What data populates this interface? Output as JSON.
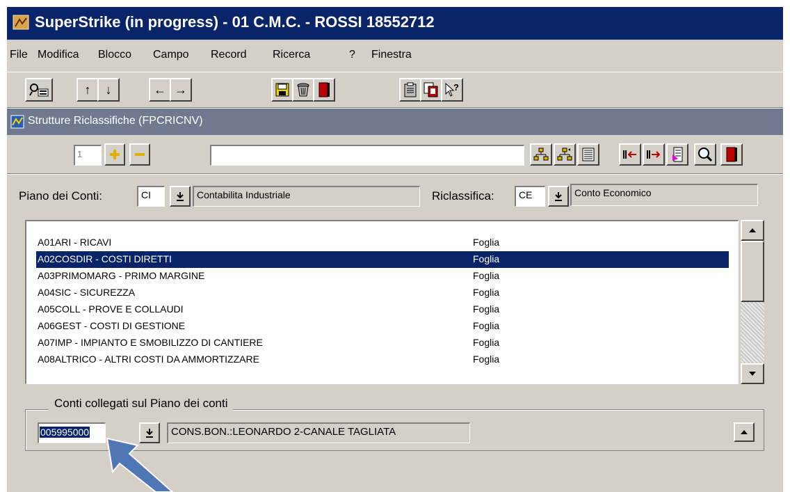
{
  "window": {
    "title": "SuperStrike (in progress) - 01 C.M.C. - ROSSI 18552712"
  },
  "menu": [
    "File",
    "Modifica",
    "Blocco",
    "Campo",
    "Record",
    "Ricerca",
    "?",
    "Finestra"
  ],
  "toolbar": {
    "buttons": [
      {
        "name": "query-icon"
      },
      {
        "name": "arrow-up-icon",
        "glyph": "↑"
      },
      {
        "name": "arrow-down-icon",
        "glyph": "↓"
      },
      {
        "name": "arrow-left-icon",
        "glyph": "←"
      },
      {
        "name": "arrow-right-icon",
        "glyph": "→"
      },
      {
        "name": "save-icon"
      },
      {
        "name": "trash-icon"
      },
      {
        "name": "exit-door-icon"
      },
      {
        "name": "clipboard-icon"
      },
      {
        "name": "copy-icon"
      },
      {
        "name": "help-pointer-icon",
        "glyph": "?"
      }
    ]
  },
  "inner_window": {
    "title": "Strutture Riclassifiche (FPCRICNV)",
    "record_number": "1",
    "search_value": ""
  },
  "form": {
    "piano_label": "Piano dei Conti:",
    "piano_code": "CI",
    "piano_desc": "Contabilita Industriale",
    "riclass_label": "Riclassifica:",
    "riclass_code": "CE",
    "riclass_desc": "Conto Economico"
  },
  "list": {
    "rows": [
      {
        "code": "A01ARI - RICAVI",
        "type": "Foglia",
        "selected": false
      },
      {
        "code": "A02COSDIR - COSTI DIRETTI",
        "type": "Foglia",
        "selected": true
      },
      {
        "code": "A03PRIMOMARG - PRIMO MARGINE",
        "type": "Foglia",
        "selected": false
      },
      {
        "code": "A04SIC - SICUREZZA",
        "type": "Foglia",
        "selected": false
      },
      {
        "code": "A05COLL - PROVE E COLLAUDI",
        "type": "Foglia",
        "selected": false
      },
      {
        "code": "A06GEST - COSTI DI GESTIONE",
        "type": "Foglia",
        "selected": false
      },
      {
        "code": "A07IMP - IMPIANTO E SMOBILIZZO DI CANTIERE",
        "type": "Foglia",
        "selected": false
      },
      {
        "code": "A08ALTRICO - ALTRI COSTI DA AMMORTIZZARE",
        "type": "Foglia",
        "selected": false
      }
    ]
  },
  "linked": {
    "group_label": "Conti collegati sul Piano dei conti",
    "account_code": "005995000",
    "account_desc": "CONS.BON.:LEONARDO 2-CANALE TAGLIATA"
  },
  "colors": {
    "title_bar": "#0a246a",
    "inner_title_bar": "#6f7a91",
    "dialog_bg": "#d4d0c8",
    "selection": "#0a246a",
    "arrow": "#4f76b5"
  }
}
